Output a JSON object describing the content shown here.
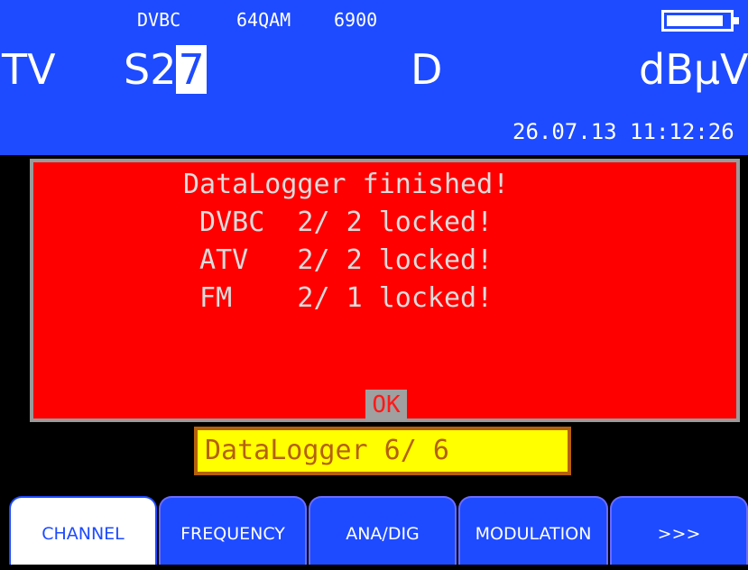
{
  "header": {
    "system": "DVBC",
    "modulation": "64QAM",
    "symbol_rate": "6900",
    "mode": "TV",
    "channel_prefix": "S2",
    "channel_cursor": "7",
    "signal_type": "D",
    "unit": "dBµV",
    "datetime": "26.07.13 11:12:26",
    "battery_icon": "battery-icon"
  },
  "dialog": {
    "lines": [
      "DataLogger finished!",
      " DVBC  2/ 2 locked!",
      " ATV   2/ 2 locked!",
      " FM    2/ 1 locked!"
    ],
    "ok_label": "OK"
  },
  "status": {
    "text": "DataLogger 6/ 6"
  },
  "softkeys": [
    {
      "label": "CHANNEL",
      "active": true
    },
    {
      "label": "FREQUENCY",
      "active": false
    },
    {
      "label": "ANA/DIG",
      "active": false
    },
    {
      "label": "MODULATION",
      "active": false
    },
    {
      "label": ">>>",
      "active": false
    }
  ],
  "colors": {
    "header_bg": "#1e4bff",
    "dialog_bg": "#ff0000",
    "status_bg": "#ffff00",
    "status_border": "#b5610b"
  }
}
